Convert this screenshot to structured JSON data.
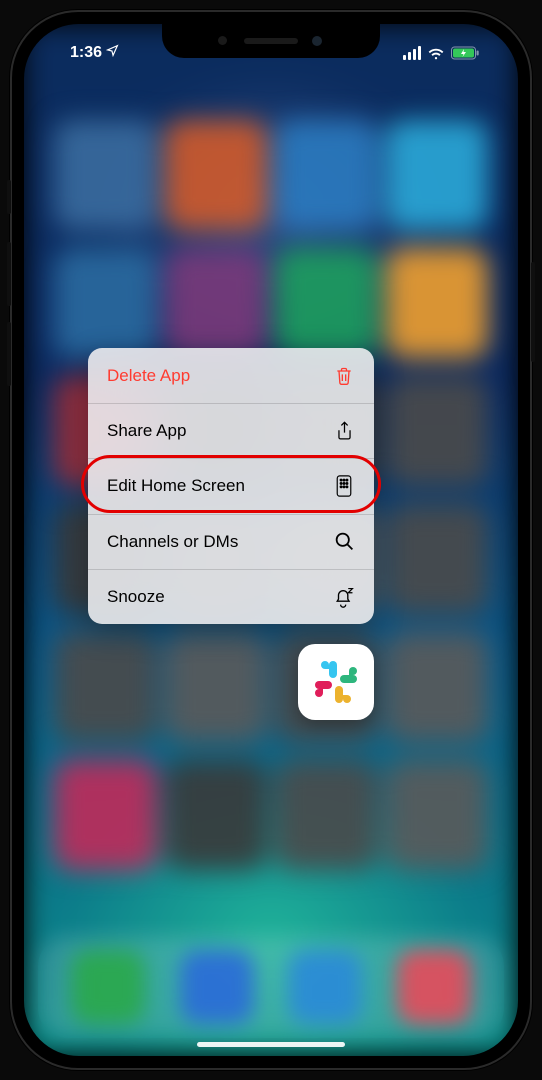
{
  "status": {
    "time": "1:36",
    "location_icon": "location-arrow"
  },
  "menu": {
    "items": [
      {
        "label": "Delete App",
        "icon": "trash-icon",
        "destructive": true
      },
      {
        "label": "Share App",
        "icon": "share-icon",
        "destructive": false
      },
      {
        "label": "Edit Home Screen",
        "icon": "apps-grid-icon",
        "destructive": false
      },
      {
        "label": "Channels or DMs",
        "icon": "search-icon",
        "destructive": false
      },
      {
        "label": "Snooze",
        "icon": "bell-snooze-icon",
        "destructive": false
      }
    ]
  },
  "focused_app": {
    "name": "Slack"
  },
  "highlight": {
    "target": "Edit Home Screen"
  },
  "colors": {
    "destructive": "#ff3b30",
    "highlight_ring": "#e20000"
  },
  "blurred_apps": [
    "#3a6b9e",
    "#d05a2a",
    "#2a7abf",
    "#2aa8d8",
    "#2a6aa0",
    "#7a3a7a",
    "#1e9e5e",
    "#f0a030",
    "#9a2d3a",
    "#2a2a2a",
    "#3a3a3a",
    "#4a4a4a",
    "#3a3a3a",
    "#4a4a4a",
    "#5a5a5a",
    "#4a4a4a",
    "#4a4a4a",
    "#5a5a5a",
    "#4a4a4a",
    "#5a5a5a",
    "#c02a5a",
    "#3a3a3a",
    "#4a4a4a",
    "#5a5a5a"
  ],
  "dock_apps": [
    "#2aa84a",
    "#2a6ad8",
    "#2a8ad8",
    "#e84a5a"
  ]
}
